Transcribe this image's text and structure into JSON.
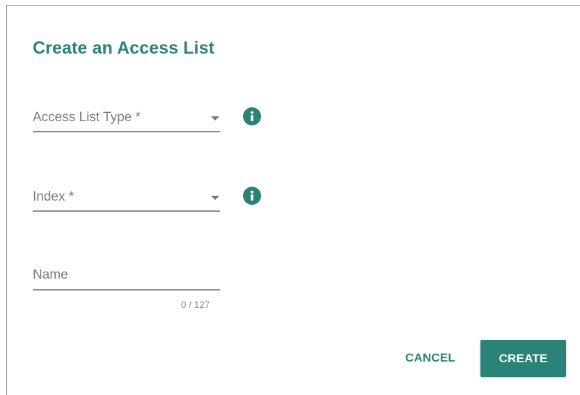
{
  "dialog": {
    "title": "Create an Access List"
  },
  "form": {
    "access_list_type": {
      "label": "Access List Type *",
      "value": "",
      "info_icon": "info-icon"
    },
    "index": {
      "label": "Index *",
      "value": "",
      "info_icon": "info-icon"
    },
    "name": {
      "label": "Name",
      "value": "",
      "counter": "0 / 127"
    }
  },
  "actions": {
    "cancel_label": "CANCEL",
    "create_label": "CREATE"
  },
  "colors": {
    "accent": "#2a8279",
    "label": "#7a7a7a",
    "underline": "#8c8c8c"
  }
}
